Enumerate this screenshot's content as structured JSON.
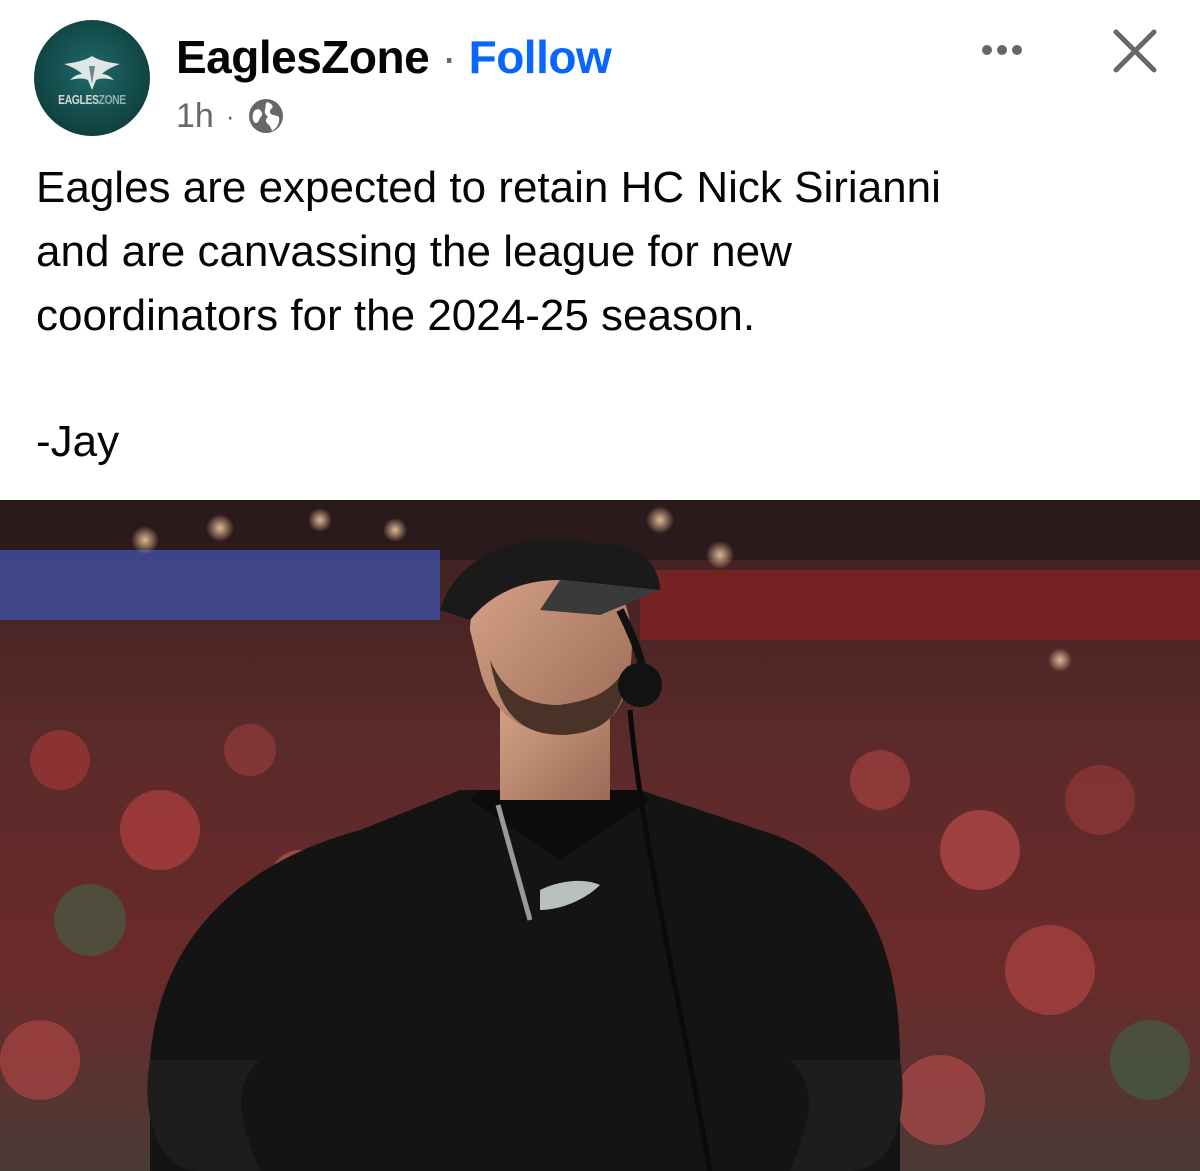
{
  "post": {
    "author": "EaglesZone",
    "separator": "·",
    "follow_label": "Follow",
    "time": "1h",
    "meta_separator": "·",
    "audience_icon": "globe-icon",
    "more_icon": "more-options-icon",
    "close_icon": "close-icon",
    "avatar": {
      "wordmark_part1": "EAGLES",
      "wordmark_part2": "ZONE",
      "colors": {
        "background": "#124847",
        "text": "#cfd8d6"
      }
    },
    "text_lines": [
      "Eagles are expected to retain HC Nick Sirianni",
      "and are canvassing the league for new",
      "coordinators for the 2024-25 season."
    ],
    "signature": "-Jay",
    "photo": {
      "subject_icon": "coach-photo"
    }
  },
  "colors": {
    "link": "#0866ff",
    "primary_text": "#050505",
    "secondary_text": "#65676b"
  }
}
